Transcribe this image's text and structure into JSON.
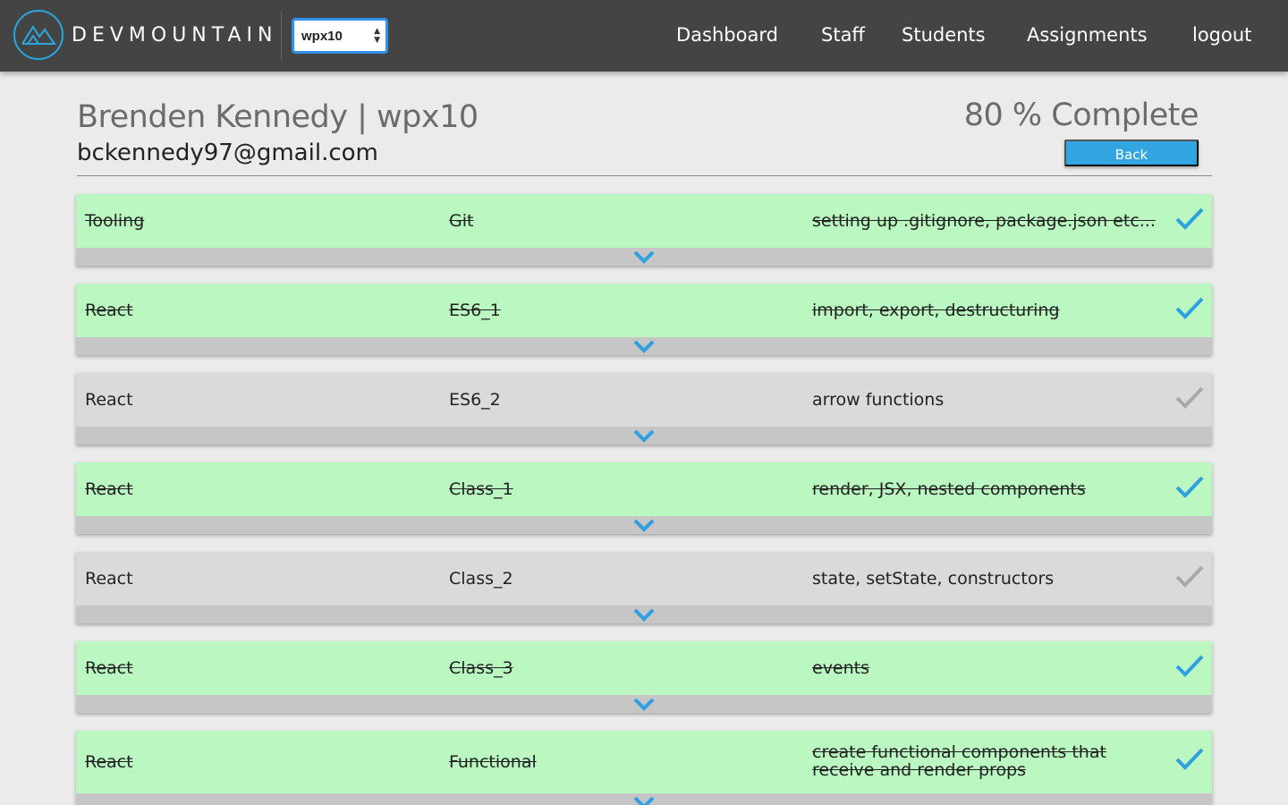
{
  "app": {
    "logo_text": "DEVMOUNTAIN",
    "cohort_select_value": "wpx10",
    "nav": [
      "Dashboard",
      "Staff",
      "Students",
      "Assignments",
      "logout"
    ]
  },
  "student": {
    "name_line": "Brenden Kennedy | wpx10",
    "email": "bckennedy97@gmail.com",
    "completion": "80 % Complete",
    "completion_percent": 80,
    "back_label": "Back"
  },
  "colors": {
    "accent": "#33a6e2",
    "complete_row": "#baf7c1",
    "incomplete_row": "#dadada",
    "check_done": "#2e9fe0",
    "check_pending": "#a9a9a9"
  },
  "icons": {
    "check": "check-icon",
    "expand": "chevron-down-icon",
    "logo": "mountain-logo-icon"
  },
  "assignments": [
    {
      "topic": "Tooling",
      "name": "Git",
      "description": "setting up .gitignore, package.json etc...",
      "complete": true
    },
    {
      "topic": "React",
      "name": "ES6_1",
      "description": "import, export, destructuring",
      "complete": true
    },
    {
      "topic": "React",
      "name": "ES6_2",
      "description": "arrow functions",
      "complete": false
    },
    {
      "topic": "React",
      "name": "Class_1",
      "description": "render, JSX, nested components",
      "complete": true
    },
    {
      "topic": "React",
      "name": "Class_2",
      "description": "state, setState, constructors",
      "complete": false
    },
    {
      "topic": "React",
      "name": "Class_3",
      "description": "events",
      "complete": true
    },
    {
      "topic": "React",
      "name": "Functional",
      "description": "create functional components that receive and render props",
      "complete": true
    }
  ]
}
